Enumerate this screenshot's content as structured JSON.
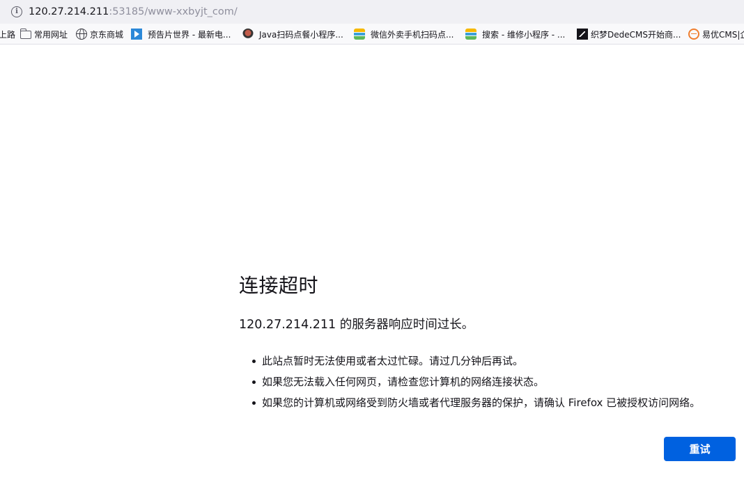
{
  "urlbar": {
    "host": "120.27.214.211",
    "rest": ":53185/www-xxbyjt_com/",
    "info_icon": "info-icon"
  },
  "bookmarks": [
    {
      "label": "上路",
      "icon": "none"
    },
    {
      "label": "常用网址",
      "icon": "folder-icon"
    },
    {
      "label": "京东商城",
      "icon": "globe-icon"
    },
    {
      "label": "预告片世界 - 最新电...",
      "icon": "play-icon"
    },
    {
      "label": "Java扫码点餐小程序...",
      "icon": "java-icon"
    },
    {
      "label": "微信外卖手机扫码点...",
      "icon": "stack-icon"
    },
    {
      "label": "搜索 - 维修小程序 - ...",
      "icon": "stack-icon"
    },
    {
      "label": "织梦DedeCMS开始商...",
      "icon": "dedecms-icon"
    },
    {
      "label": "易优CMS|企",
      "icon": "eyoucms-icon"
    }
  ],
  "error": {
    "title": "连接超时",
    "description": "120.27.214.211 的服务器响应时间过长。",
    "items": [
      "此站点暂时无法使用或者太过忙碌。请过几分钟后再试。",
      "如果您无法载入任何网页，请检查您计算机的网络连接状态。",
      "如果您的计算机或网络受到防火墙或者代理服务器的保护，请确认 Firefox 已被授权访问网络。"
    ],
    "retry_label": "重试"
  },
  "colors": {
    "accent": "#0061e0",
    "urlbar_bg": "#f0f0f4",
    "text": "#15141a",
    "url_muted": "#8f8f9d"
  }
}
